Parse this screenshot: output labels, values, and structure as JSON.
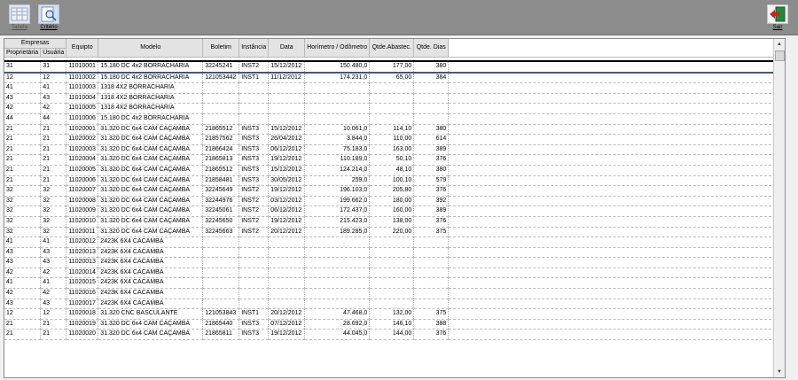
{
  "toolbar": {
    "tabela_label": "Tabela",
    "criterio_label": "Critério",
    "sair_label": "Sair"
  },
  "grid": {
    "group_header": "Empresas",
    "headers": {
      "proprietaria": "Proprietária",
      "usuaria": "Usuária",
      "equipto": "Equipto",
      "modelo": "Modelo",
      "boletim": "Boletim",
      "instancia": "Instância",
      "data": "Data",
      "horimetro": "Horímetro / Odômetro",
      "qtde_abastec": "Qtde.Abastec.",
      "qtde_dias": "Qtde. Dias"
    },
    "rows": [
      [
        "31",
        "31",
        "11010001",
        "15.180 DC 4x2 BORRACHARIA",
        "32245241",
        "INST2",
        "15/12/2012",
        "150.480,0",
        "177,00",
        "380"
      ],
      [
        "12",
        "12",
        "11010002",
        "15.180 DC 4x2 BORRACHARIA",
        "121053442",
        "INST1",
        "11/12/2012",
        "174.231,0",
        "65,00",
        "384"
      ],
      [
        "41",
        "41",
        "11010003",
        "1318 4X2 BORRACHARIA",
        "",
        "",
        "",
        "",
        "",
        ""
      ],
      [
        "43",
        "43",
        "11010004",
        "1318 4X2 BORRACHARIA",
        "",
        "",
        "",
        "",
        "",
        ""
      ],
      [
        "42",
        "42",
        "11010005",
        "1318 4X2 BORRACHARIA",
        "",
        "",
        "",
        "",
        "",
        ""
      ],
      [
        "44",
        "44",
        "11010006",
        "15.180 DC 4x2 BORRACHARIA",
        "",
        "",
        "",
        "",
        "",
        ""
      ],
      [
        "21",
        "21",
        "11020001",
        "31.320 DC 6x4 CAM CAÇAMBA",
        "21865512",
        "INST3",
        "15/12/2012",
        "10.061,0",
        "114,10",
        "380"
      ],
      [
        "21",
        "21",
        "11020002",
        "31.320 DC 6x4 CAM CAÇAMBA",
        "21857562",
        "INST3",
        "26/04/2012",
        "3.844,0",
        "110,00",
        "614"
      ],
      [
        "21",
        "21",
        "11020003",
        "31.320 DC 6x4 CAM CAÇAMBA",
        "21866424",
        "INST3",
        "06/12/2012",
        "75.183,0",
        "163,00",
        "389"
      ],
      [
        "21",
        "21",
        "11020004",
        "31.320 DC 6x4 CAM CAÇAMBA",
        "21865813",
        "INST3",
        "19/12/2012",
        "110.189,0",
        "50,10",
        "376"
      ],
      [
        "21",
        "21",
        "11020005",
        "31.320 DC 6x4 CAM CAÇAMBA",
        "21865512",
        "INST3",
        "15/12/2012",
        "124.214,0",
        "48,10",
        "380"
      ],
      [
        "21",
        "21",
        "11020006",
        "31.320 DC 6x4 CAM CAÇAMBA",
        "21858481",
        "INST3",
        "30/05/2012",
        "259,0",
        "100,10",
        "579"
      ],
      [
        "32",
        "32",
        "11020007",
        "31.320 DC 6x4 CAM CAÇAMBA",
        "32245649",
        "INST2",
        "19/12/2012",
        "196.103,0",
        "205,80",
        "376"
      ],
      [
        "32",
        "32",
        "11020008",
        "31.320 DC 6x4 CAM CAÇAMBA",
        "32244976",
        "INST2",
        "03/12/2012",
        "199.662,0",
        "180,00",
        "392"
      ],
      [
        "32",
        "32",
        "11020009",
        "31.320 DC 6x4 CAM CAÇAMBA",
        "32245061",
        "INST2",
        "06/12/2012",
        "172.437,0",
        "160,00",
        "389"
      ],
      [
        "32",
        "32",
        "11020010",
        "31.320 DC 6x4 CAM CAÇAMBA",
        "32245650",
        "INST2",
        "19/12/2012",
        "215.423,0",
        "138,00",
        "376"
      ],
      [
        "32",
        "32",
        "11020011",
        "31.320 DC 6x4 CAM CAÇAMBA",
        "32245663",
        "INST2",
        "20/12/2012",
        "189.285,0",
        "220,00",
        "375"
      ],
      [
        "41",
        "41",
        "11020012",
        "2423K 6X4 CACAMBA",
        "",
        "",
        "",
        "",
        "",
        ""
      ],
      [
        "43",
        "43",
        "11020013",
        "2423K 6X4 CACAMBA",
        "",
        "",
        "",
        "",
        "",
        ""
      ],
      [
        "43",
        "43",
        "11020013",
        "2423K 6X4 CACAMBA",
        "",
        "",
        "",
        "",
        "",
        ""
      ],
      [
        "42",
        "42",
        "11020014",
        "2423K 6X4 CACAMBA",
        "",
        "",
        "",
        "",
        "",
        ""
      ],
      [
        "41",
        "41",
        "11020015",
        "2423K 6X4 CACAMBA",
        "",
        "",
        "",
        "",
        "",
        ""
      ],
      [
        "42",
        "42",
        "11020016",
        "2423K 6X4 CACAMBA",
        "",
        "",
        "",
        "",
        "",
        ""
      ],
      [
        "43",
        "43",
        "11020017",
        "2423K 6X4 CACAMBA",
        "",
        "",
        "",
        "",
        "",
        ""
      ],
      [
        "12",
        "12",
        "11020018",
        "31.320 CNC BASCULANTE",
        "121053843",
        "INST1",
        "20/12/2012",
        "47.468,0",
        "132,00",
        "375"
      ],
      [
        "21",
        "21",
        "11020019",
        "31.320 DC 6x4 CAM CAÇAMBA",
        "21865440",
        "INST3",
        "07/12/2012",
        "28.692,0",
        "146,10",
        "388"
      ],
      [
        "21",
        "21",
        "11020020",
        "31.320 DC 6x4 CAM CAÇAMBA",
        "21865811",
        "INST3",
        "19/12/2012",
        "44.045,0",
        "144,00",
        "376"
      ]
    ]
  }
}
